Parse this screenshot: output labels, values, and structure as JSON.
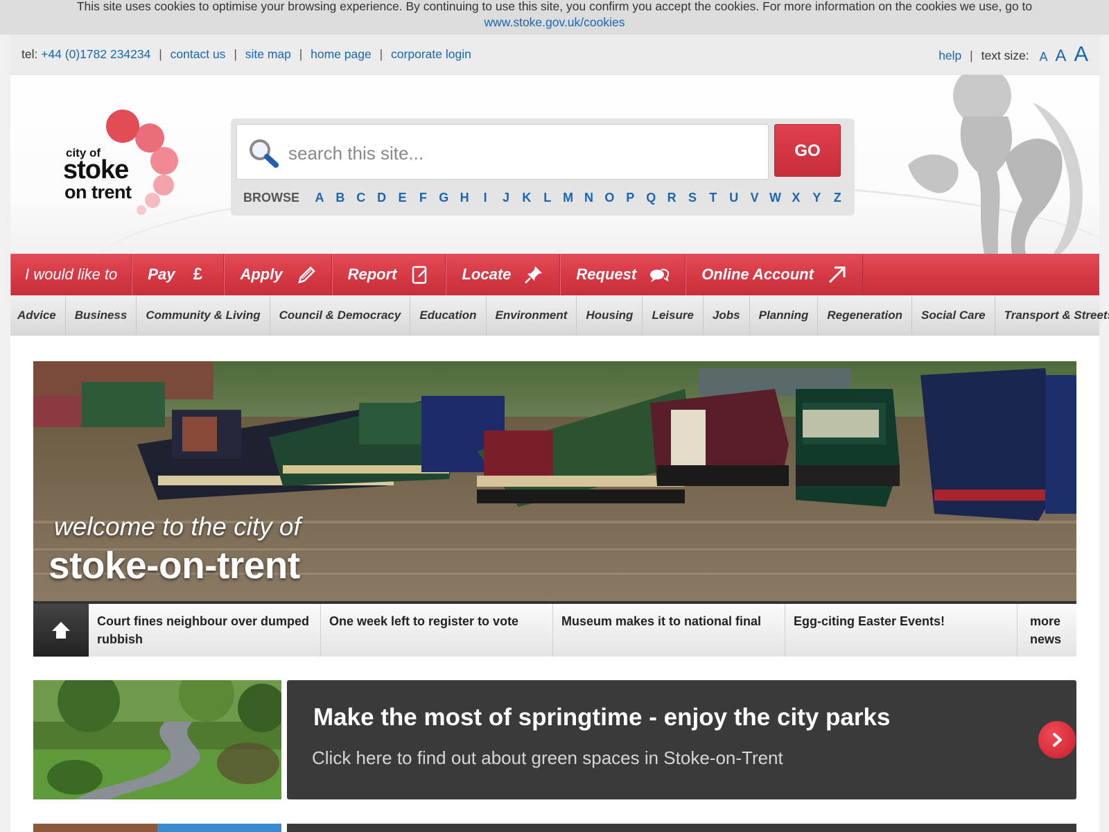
{
  "cookie": {
    "text": "This site uses cookies to optimise your browsing experience. By continuing to use this site, you confirm you accept the cookies. For more information on the cookies we use, go to",
    "link": "www.stoke.gov.uk/cookies"
  },
  "topbar": {
    "tel_label": "tel:",
    "tel": "+44 (0)1782 234234",
    "links": [
      "contact us",
      "site map",
      "home page",
      "corporate login"
    ],
    "help": "help",
    "text_size_label": "text size:",
    "sizes": [
      "A",
      "A",
      "A"
    ]
  },
  "logo": {
    "city_of": "city of",
    "stoke": "stoke",
    "on_trent": "on trent"
  },
  "search": {
    "placeholder": "search this site...",
    "go": "GO",
    "browse_label": "BROWSE",
    "letters": [
      "A",
      "B",
      "C",
      "D",
      "E",
      "F",
      "G",
      "H",
      "I",
      "J",
      "K",
      "L",
      "M",
      "N",
      "O",
      "P",
      "Q",
      "R",
      "S",
      "T",
      "U",
      "V",
      "W",
      "X",
      "Y",
      "Z"
    ]
  },
  "action_nav": {
    "intro": "I would like to",
    "items": [
      "Pay",
      "Apply",
      "Report",
      "Locate",
      "Request",
      "Online Account"
    ]
  },
  "category_nav": [
    "Advice",
    "Business",
    "Community & Living",
    "Council & Democracy",
    "Education",
    "Environment",
    "Housing",
    "Leisure",
    "Jobs",
    "Planning",
    "Regeneration",
    "Social Care",
    "Transport & Streets"
  ],
  "hero": {
    "welcome": "welcome to the city of",
    "city": "stoke-on-trent"
  },
  "news": {
    "items": [
      "Court fines neighbour over dumped rubbish",
      "One week left to register to vote",
      "Museum makes it to national final",
      "Egg-citing Easter Events!"
    ],
    "more": "more news"
  },
  "promo": {
    "title": "Make the most of springtime - enjoy the city parks",
    "subtitle": "Click here to find out about green spaces in Stoke-on-Trent"
  },
  "colors": {
    "brand_red": "#d63a46",
    "link_blue": "#1a66b3",
    "dark": "#3a3a3a"
  }
}
